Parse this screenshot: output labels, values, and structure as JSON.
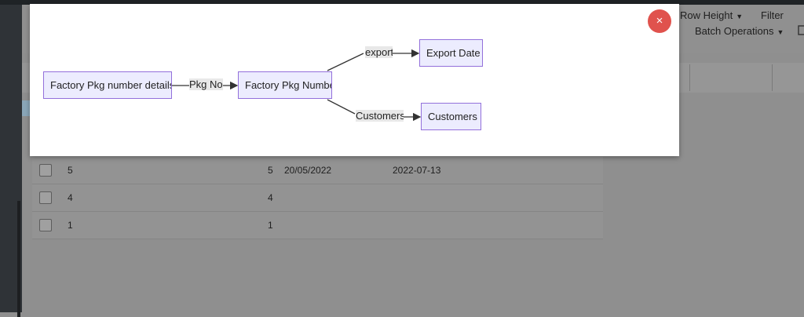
{
  "header": {
    "batch_operations_label": "Batch Operations",
    "caret": "▼"
  },
  "toolbar": {
    "row_height_label": "Row Height",
    "filter_label": "Filter"
  },
  "table": {
    "rows": [
      {
        "id": "5",
        "num": "5",
        "date1": "20/05/2022",
        "date2": "2022-07-13"
      },
      {
        "id": "4",
        "num": "4",
        "date1": "",
        "date2": ""
      },
      {
        "id": "1",
        "num": "1",
        "date1": "",
        "date2": ""
      }
    ]
  },
  "modal": {
    "close_label": "×",
    "diagram": {
      "nodes": {
        "source": "Factory Pkg number details",
        "middle": "Factory Pkg Number",
        "export": "Export Date",
        "customers": "Customers"
      },
      "edges": {
        "pkg_no": "Pkg No",
        "export": "export",
        "customers": "Customers"
      }
    }
  }
}
